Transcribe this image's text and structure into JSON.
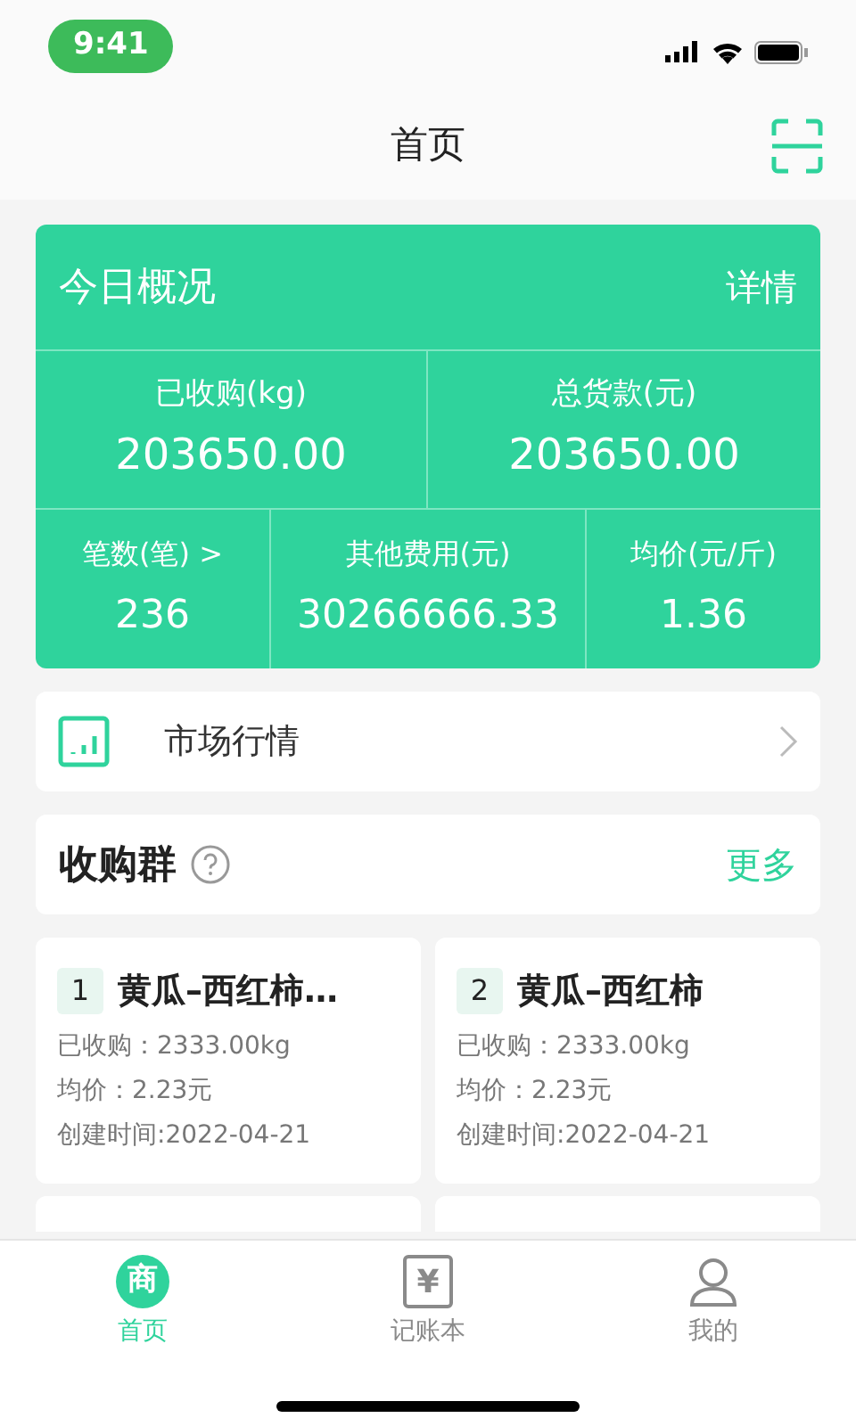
{
  "status_bar": {
    "time": "9:41"
  },
  "header": {
    "title": "首页"
  },
  "overview": {
    "title": "今日概况",
    "detail_link": "详情",
    "top_stats": [
      {
        "label": "已收购(kg)",
        "value": "203650.00"
      },
      {
        "label": "总货款(元)",
        "value": "203650.00"
      }
    ],
    "bottom_stats": [
      {
        "label": "笔数(笔) >",
        "value": "236"
      },
      {
        "label": "其他费用(元)",
        "value": "30266666.33"
      },
      {
        "label": "均价(元/斤)",
        "value": "1.36"
      }
    ]
  },
  "market_row": {
    "label": "市场行情"
  },
  "groups": {
    "title": "收购群",
    "more_link": "更多",
    "cards": [
      {
        "index": "1",
        "name": "黄瓜–西红柿…",
        "purchased": "已收购：2333.00kg",
        "avg_price": "均价：2.23元",
        "created": "创建时间:2022-04-21"
      },
      {
        "index": "2",
        "name": "黄瓜–西红柿",
        "purchased": "已收购：2333.00kg",
        "avg_price": "均价：2.23元",
        "created": "创建时间:2022-04-21"
      }
    ]
  },
  "tab_bar": [
    {
      "label": "首页",
      "icon_glyph": "商",
      "kind": "badge",
      "selected": true
    },
    {
      "label": "记账本",
      "icon_glyph": "¥",
      "kind": "ledger",
      "selected": false
    },
    {
      "label": "我的",
      "kind": "person",
      "selected": false
    }
  ]
}
